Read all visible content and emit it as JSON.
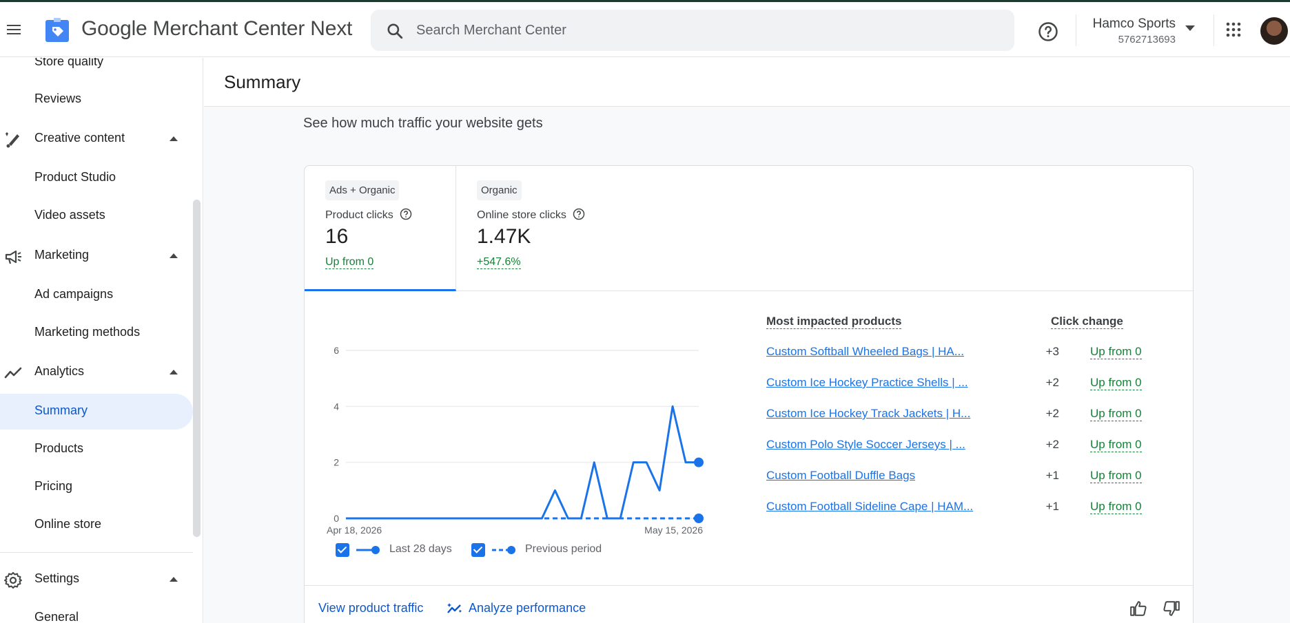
{
  "header": {
    "app_title_google": "Google",
    "app_title_rest": " Merchant Center Next",
    "search_placeholder": "Search Merchant Center",
    "account_name": "Hamco Sports",
    "account_id": "5762713693",
    "icons": [
      "menu-icon",
      "merchant-logo-icon",
      "search-icon",
      "help-icon",
      "apps-icon",
      "avatar"
    ]
  },
  "sidebar": {
    "items": [
      {
        "label": "Store quality",
        "type": "sub"
      },
      {
        "label": "Reviews",
        "type": "sub"
      },
      {
        "label": "Creative content",
        "type": "section",
        "icon": "brush-icon"
      },
      {
        "label": "Product Studio",
        "type": "sub"
      },
      {
        "label": "Video assets",
        "type": "sub"
      },
      {
        "label": "Marketing",
        "type": "section",
        "icon": "megaphone-icon"
      },
      {
        "label": "Ad campaigns",
        "type": "sub"
      },
      {
        "label": "Marketing methods",
        "type": "sub"
      },
      {
        "label": "Analytics",
        "type": "section",
        "icon": "trending-icon"
      },
      {
        "label": "Summary",
        "type": "sub",
        "active": true
      },
      {
        "label": "Products",
        "type": "sub"
      },
      {
        "label": "Pricing",
        "type": "sub"
      },
      {
        "label": "Online store",
        "type": "sub"
      },
      {
        "label": "Settings",
        "type": "section",
        "icon": "gear-icon"
      },
      {
        "label": "General",
        "type": "sub"
      }
    ]
  },
  "main": {
    "page_title": "Summary",
    "section_heading": "See how much traffic your website gets",
    "metrics": [
      {
        "chip": "Ads + Organic",
        "label": "Product clicks",
        "value": "16",
        "change": "Up from 0",
        "selected": true
      },
      {
        "chip": "Organic",
        "label": "Online store clicks",
        "value": "1.47K",
        "change": "+547.6%",
        "selected": false
      }
    ],
    "impacted_header": "Most impacted products",
    "click_change_header": "Click change",
    "products": [
      {
        "name": "Custom Softball Wheeled Bags | HA...",
        "delta": "+3",
        "change": "Up from 0"
      },
      {
        "name": "Custom Ice Hockey Practice Shells | ...",
        "delta": "+2",
        "change": "Up from 0"
      },
      {
        "name": "Custom Ice Hockey Track Jackets | H...",
        "delta": "+2",
        "change": "Up from 0"
      },
      {
        "name": "Custom Polo Style Soccer Jerseys | ...",
        "delta": "+2",
        "change": "Up from 0"
      },
      {
        "name": "Custom Football Duffle Bags",
        "delta": "+1",
        "change": "Up from 0"
      },
      {
        "name": "Custom Football Sideline Cape | HAM...",
        "delta": "+1",
        "change": "Up from 0"
      }
    ],
    "legend": {
      "current": "Last 28 days",
      "previous": "Previous period"
    },
    "footer": {
      "view_traffic": "View product traffic",
      "analyze": "Analyze performance"
    },
    "colors": {
      "accent": "#1a73e8",
      "positive": "#188038",
      "active_bg": "#e8f0fe"
    }
  },
  "chart_data": {
    "type": "line",
    "x_start_label": "Apr 18, 2026",
    "x_end_label": "May 15, 2026",
    "ylim": [
      0,
      6
    ],
    "yticks": [
      0,
      2,
      4,
      6
    ],
    "grid": true,
    "legend_position": "bottom",
    "series": [
      {
        "name": "Last 28 days",
        "style": "solid",
        "values": [
          0,
          0,
          0,
          0,
          0,
          0,
          0,
          0,
          0,
          0,
          0,
          0,
          0,
          0,
          0,
          0,
          1,
          0,
          0,
          2,
          0,
          0,
          2,
          2,
          1,
          4,
          2,
          2
        ]
      },
      {
        "name": "Previous period",
        "style": "dashed",
        "values": [
          0,
          0,
          0,
          0,
          0,
          0,
          0,
          0,
          0,
          0,
          0,
          0,
          0,
          0,
          0,
          0,
          0,
          0,
          0,
          0,
          0,
          0,
          0,
          0,
          0,
          0,
          0,
          0
        ]
      }
    ]
  }
}
